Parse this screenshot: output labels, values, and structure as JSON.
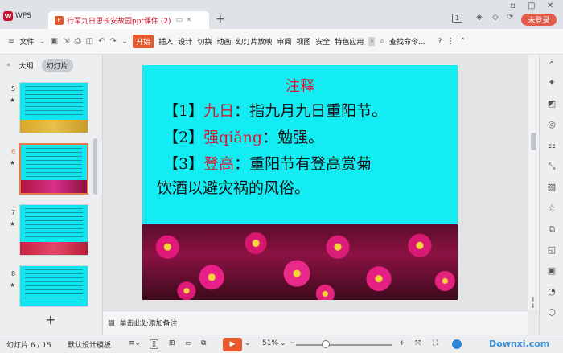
{
  "titlebar": {
    "app_label": "WPS",
    "doc_tab_title": "行军九日思长安故园ppt课件 (2)",
    "doc_tab_ext": "P",
    "new_tab": "+",
    "login_button": "未登录",
    "page_badge": "1"
  },
  "menubar": {
    "file": "文件",
    "items": [
      "开始",
      "插入",
      "设计",
      "切换",
      "动画",
      "幻灯片放映",
      "审阅",
      "视图",
      "安全",
      "特色应用"
    ],
    "search": "查找命令...",
    "help": "?"
  },
  "left_panel": {
    "tabs": [
      "大纲",
      "幻灯片"
    ],
    "thumbnails": [
      {
        "num": "5"
      },
      {
        "num": "6"
      },
      {
        "num": "7"
      },
      {
        "num": "8"
      }
    ],
    "add_slide": "+"
  },
  "slide": {
    "title": "注释",
    "lines": [
      {
        "prefix": "【1】",
        "term": "九日",
        "rest": "：指九月九日重阳节。"
      },
      {
        "prefix": "【2】",
        "term": "强qiǎng",
        "rest": "：勉强。"
      },
      {
        "prefix": "【3】",
        "term": "登高",
        "rest": "：重阳节有登高赏菊"
      }
    ],
    "line4": "饮酒以避灾祸的风俗。",
    "colors": {
      "background": "#12ecf2",
      "accent": "#d8182d"
    }
  },
  "notes": {
    "placeholder": "单击此处添加备注"
  },
  "statusbar": {
    "slide_pos": "幻灯片 6 / 15",
    "template": "默认设计模板",
    "zoom": "51%",
    "zoom_minus": "−",
    "zoom_plus": "+",
    "watermark": "Downxi.com"
  }
}
